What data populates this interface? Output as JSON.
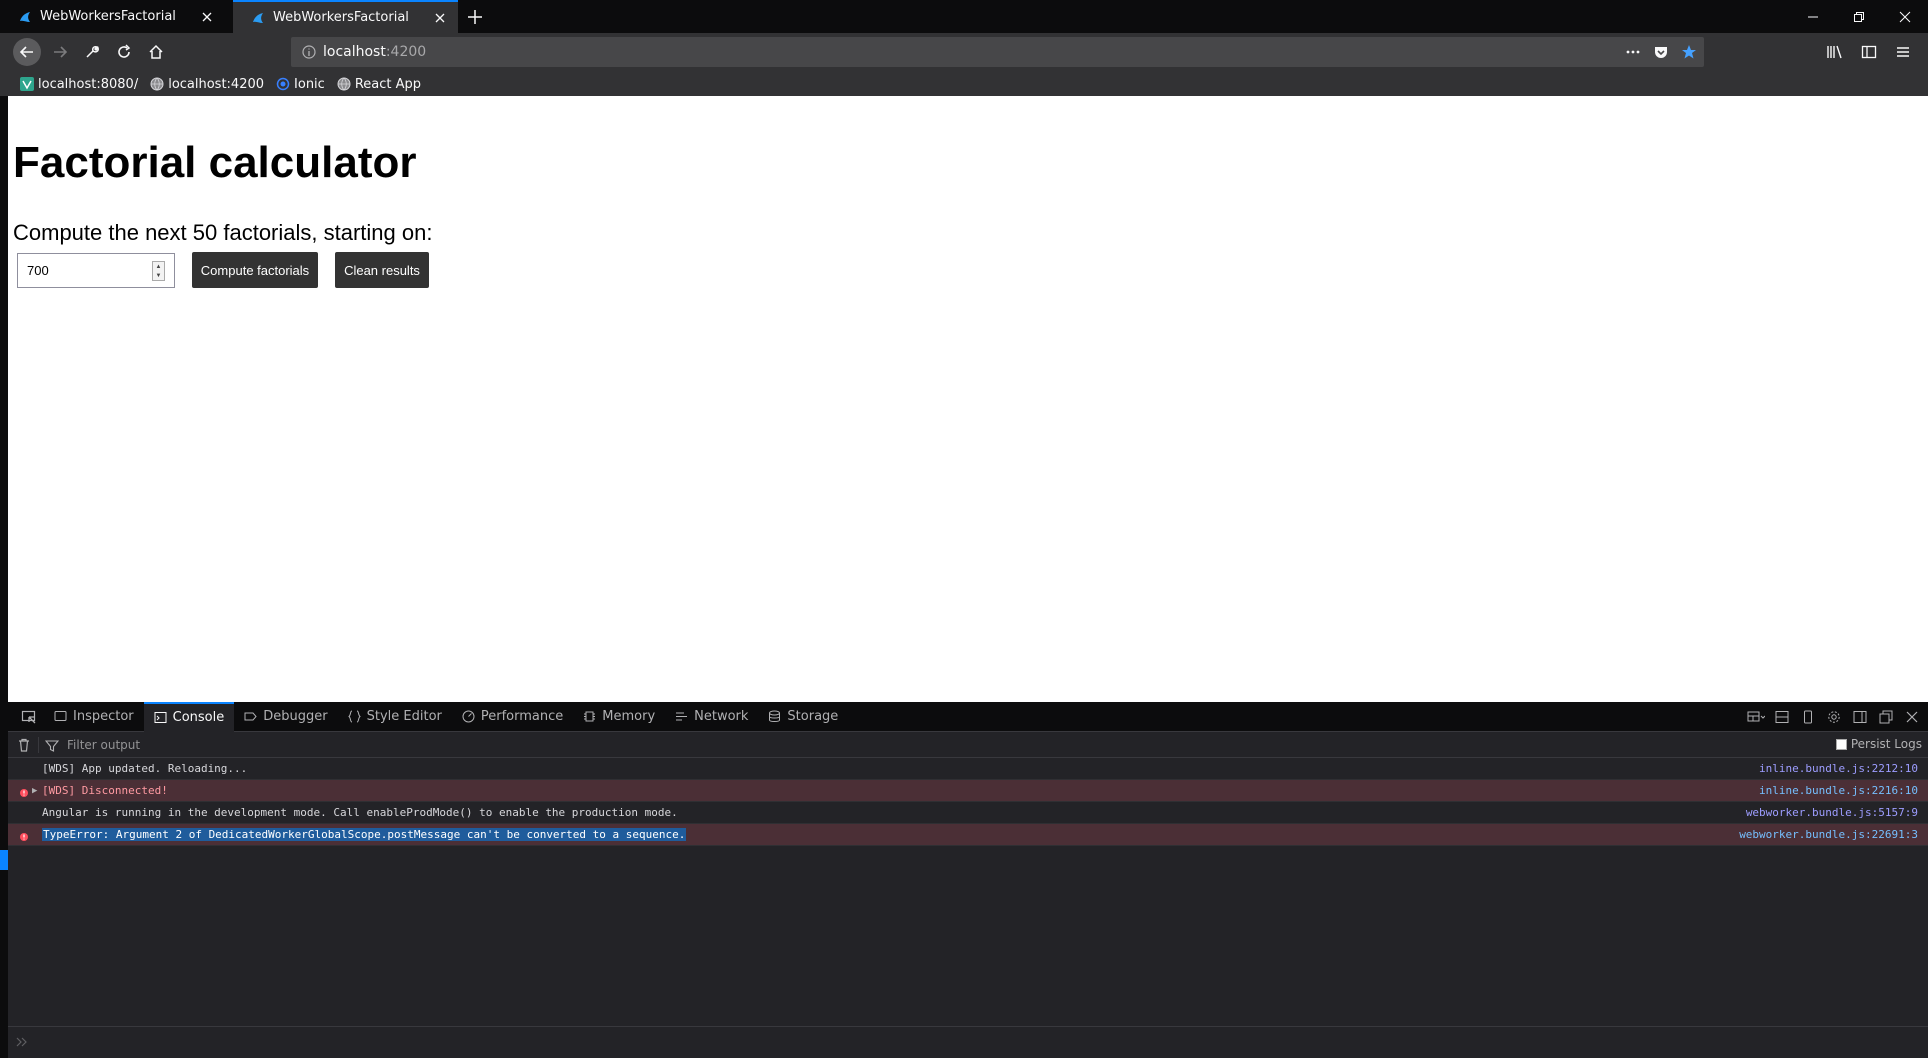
{
  "browser": {
    "tabs": [
      {
        "title": "WebWorkersFactorial",
        "active": false
      },
      {
        "title": "WebWorkersFactorial",
        "active": true
      }
    ],
    "url": {
      "host": "localhost",
      "port": ":4200"
    },
    "bookmarks": [
      {
        "label": "localhost:8080/",
        "icon": "vue-icon"
      },
      {
        "label": "localhost:4200",
        "icon": "globe-icon"
      },
      {
        "label": "Ionic",
        "icon": "ionic-icon"
      },
      {
        "label": "React App",
        "icon": "globe-icon"
      }
    ],
    "accent_color": "#0a84ff"
  },
  "page": {
    "heading": "Factorial calculator",
    "prompt": "Compute the next 50 factorials, starting on:",
    "input_value": "700",
    "compute_button": "Compute factorials",
    "clean_button": "Clean results"
  },
  "devtools": {
    "tabs": [
      {
        "label": "Inspector",
        "icon": "inspector-icon"
      },
      {
        "label": "Console",
        "icon": "console-icon",
        "active": true
      },
      {
        "label": "Debugger",
        "icon": "debugger-icon"
      },
      {
        "label": "Style Editor",
        "icon": "style-editor-icon"
      },
      {
        "label": "Performance",
        "icon": "performance-icon"
      },
      {
        "label": "Memory",
        "icon": "memory-icon"
      },
      {
        "label": "Network",
        "icon": "network-icon"
      },
      {
        "label": "Storage",
        "icon": "storage-icon"
      }
    ],
    "filter_placeholder": "Filter output",
    "persist_logs": "Persist Logs",
    "logs": [
      {
        "level": "info",
        "message": "[WDS] App updated. Reloading...",
        "source": "inline.bundle.js:2212:10"
      },
      {
        "level": "error",
        "message": "[WDS] Disconnected!",
        "source": "inline.bundle.js:2216:10"
      },
      {
        "level": "info",
        "message": "Angular is running in the development mode. Call enableProdMode() to enable the production mode.",
        "source": "webworker.bundle.js:5157:9"
      },
      {
        "level": "error",
        "message": "TypeError: Argument 2 of DedicatedWorkerGlobalScope.postMessage can't be converted to a sequence.",
        "source": "webworker.bundle.js:22691:3"
      }
    ],
    "error_color": "#ff4f5e"
  }
}
